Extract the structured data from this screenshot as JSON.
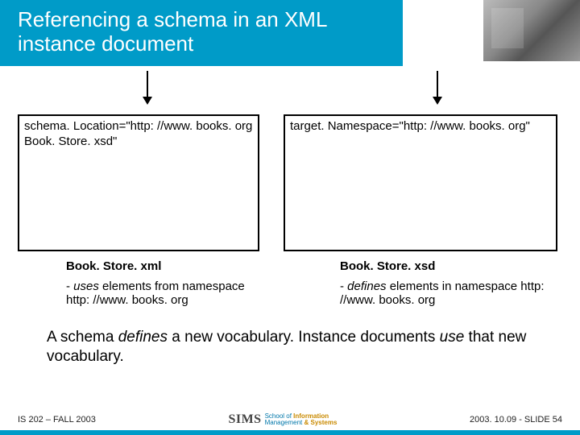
{
  "title": "Referencing a schema in an XML instance document",
  "leftBox": "schema. Location=\"http: //www. books. org Book. Store. xsd\"",
  "rightBox": "target. Namespace=\"http: //www. books. org\"",
  "leftCaption": {
    "filename": "Book. Store. xml",
    "desc_pre": "- ",
    "desc_em": "uses",
    "desc_post": " elements from namespace http: //www. books. org"
  },
  "rightCaption": {
    "filename": "Book. Store. xsd",
    "desc_pre": "- ",
    "desc_em": "defines",
    "desc_post": " elements in namespace http: //www. books. org"
  },
  "summary_1": "A schema ",
  "summary_em1": "defines",
  "summary_2": " a new vocabulary.  Instance documents ",
  "summary_em2": "use",
  "summary_3": " that new vocabulary.",
  "footer": {
    "left": "IS 202 – FALL 2003",
    "right": "2003. 10.09 - SLIDE 54",
    "logo_main": "SIMS",
    "logo_line1a": "School of ",
    "logo_line1b": "Information",
    "logo_line2a": "Management ",
    "logo_line2b": "& Systems"
  }
}
